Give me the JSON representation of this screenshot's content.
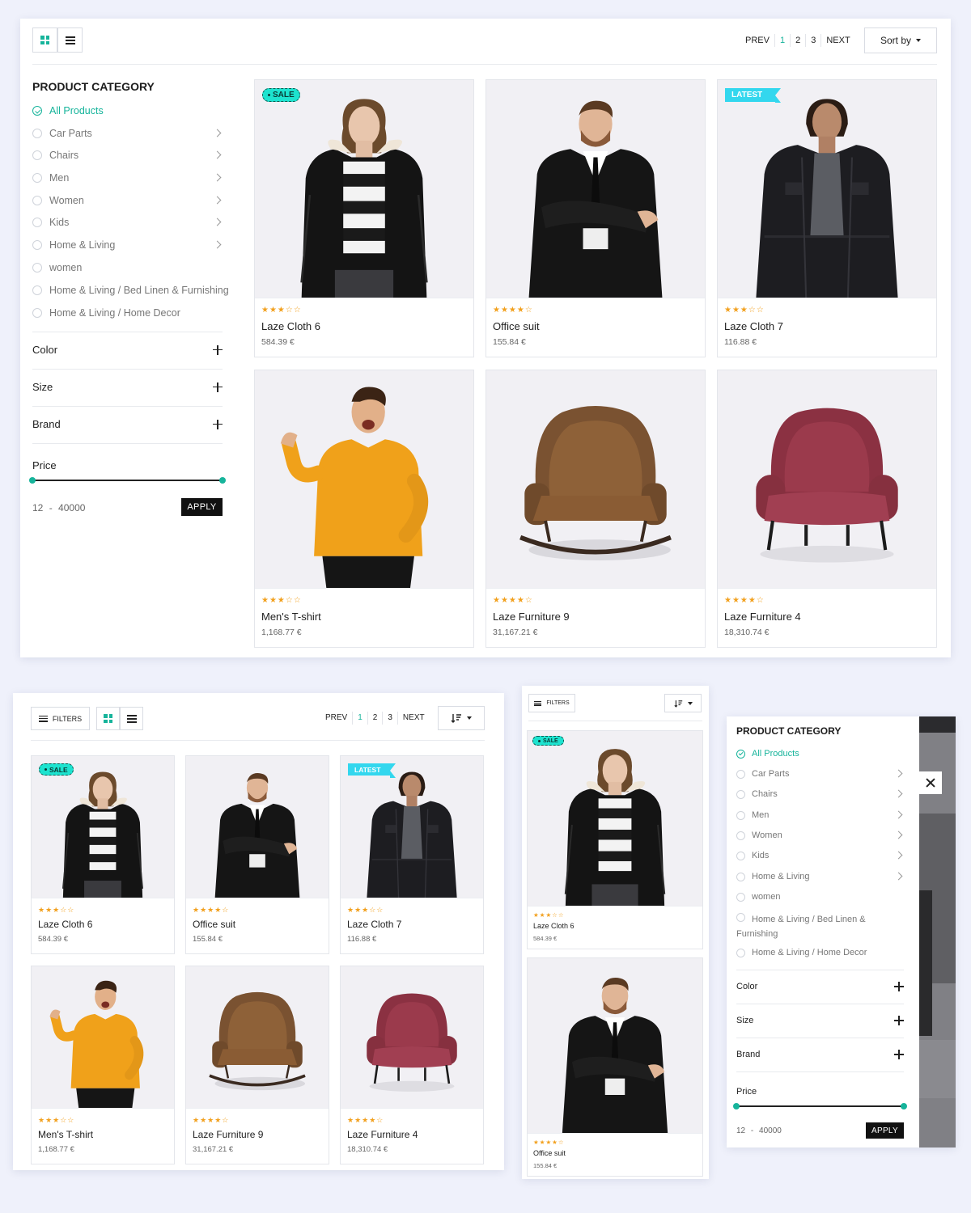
{
  "toolbar": {
    "prev": "PREV",
    "next": "NEXT",
    "pages": [
      "1",
      "2",
      "3"
    ],
    "current_page": "1",
    "sort_label": "Sort by",
    "filters_label": "FILTERS"
  },
  "sidebar": {
    "title": "PRODUCT CATEGORY",
    "categories": [
      {
        "label": "All Products",
        "active": true,
        "has_children": false
      },
      {
        "label": "Car Parts",
        "active": false,
        "has_children": true
      },
      {
        "label": "Chairs",
        "active": false,
        "has_children": true
      },
      {
        "label": "Men",
        "active": false,
        "has_children": true
      },
      {
        "label": "Women",
        "active": false,
        "has_children": true
      },
      {
        "label": "Kids",
        "active": false,
        "has_children": true
      },
      {
        "label": "Home & Living",
        "active": false,
        "has_children": true
      },
      {
        "label": "women",
        "active": false,
        "has_children": false
      },
      {
        "label": "Home & Living / Bed Linen & Furnishing",
        "active": false,
        "has_children": false
      },
      {
        "label": "Home & Living / Home Decor",
        "active": false,
        "has_children": false
      }
    ],
    "mobile_wrapped": {
      "line1": "Home & Living / Bed Linen &",
      "line2": "Furnishing"
    },
    "facets": [
      "Color",
      "Size",
      "Brand"
    ],
    "price": {
      "label": "Price",
      "min": "12",
      "max": "40000",
      "separator": "-",
      "apply": "APPLY"
    }
  },
  "products": [
    {
      "name": "Laze Cloth 6",
      "price": "584.39 €",
      "rating": 3,
      "badge": "SALE",
      "image": "woman-striped-puffer-jacket"
    },
    {
      "name": "Office suit",
      "price": "155.84 €",
      "rating": 4,
      "badge": "",
      "image": "man-black-suit"
    },
    {
      "name": "Laze Cloth 7",
      "price": "116.88 €",
      "rating": 3,
      "badge": "LATEST",
      "image": "woman-denim-jacket"
    },
    {
      "name": "Men's T-shirt",
      "price": "1,168.77 €",
      "rating": 3,
      "badge": "",
      "image": "man-yellow-sweater"
    },
    {
      "name": "Laze Furniture 9",
      "price": "31,167.21 €",
      "rating": 4,
      "badge": "",
      "image": "brown-leather-rocking-chair"
    },
    {
      "name": "Laze Furniture 4",
      "price": "18,310.74 €",
      "rating": 4,
      "badge": "",
      "image": "red-velvet-armchair"
    }
  ],
  "icons": {
    "grid_view": "grid-icon",
    "list_view": "list-icon",
    "filters": "hamburger-icon",
    "sort": "sort-icon",
    "close": "close-icon",
    "expand": "plus-icon",
    "category_more": "chevron-right-icon",
    "check": "check-circle-icon",
    "rating": "star-icon"
  },
  "colors": {
    "accent": "#16b49b",
    "star": "#f2a01d",
    "sale_badge": "#1de3cf",
    "latest_badge": "#33d7ee",
    "background": "#eff1fb"
  }
}
